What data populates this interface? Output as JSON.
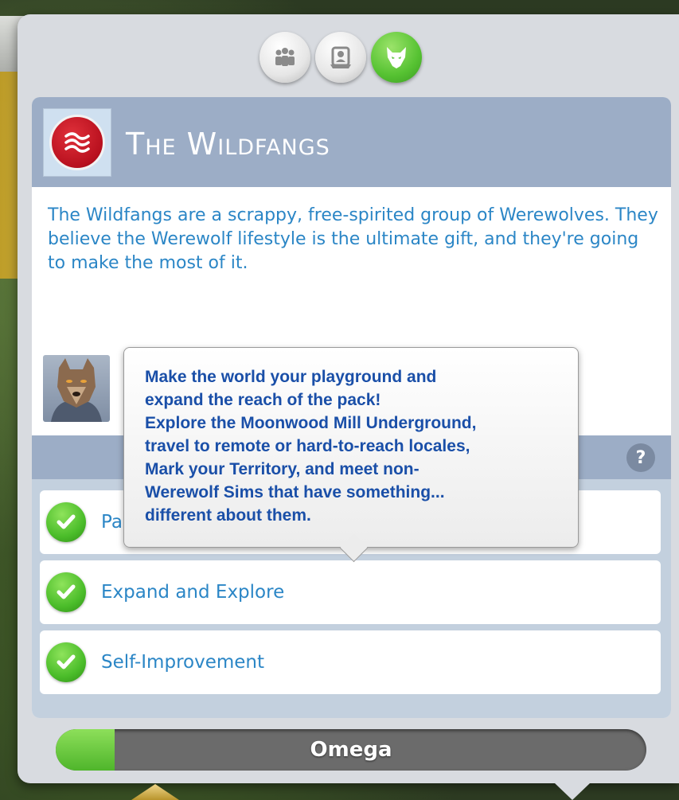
{
  "tabs": [
    {
      "icon": "group-icon",
      "active": false
    },
    {
      "icon": "portrait-badge-icon",
      "active": false
    },
    {
      "icon": "wolf-icon",
      "active": true
    }
  ],
  "pack": {
    "name": "The Wildfangs",
    "emblem_icon": "claw-marks-icon",
    "description": "The Wildfangs are a scrappy, free-spirited group of Werewolves. They believe the Werewolf lifestyle is the ultimate gift, and they're going to make the most of it."
  },
  "goals": {
    "help_label": "?",
    "items": [
      {
        "label": "Pa",
        "completed": true
      },
      {
        "label": "Expand and Explore",
        "completed": true
      },
      {
        "label": "Self-Improvement",
        "completed": true
      }
    ]
  },
  "tooltip": {
    "line1": "Make the world your playground and",
    "line2": "expand the reach of the pack!",
    "line3": "Explore the Moonwood Mill Underground,",
    "line4": "travel to remote or hard-to-reach locales,",
    "line5": "Mark your Territory, and meet non-",
    "line6": "Werewolf Sims that have something...",
    "line7": "different about them."
  },
  "rank": {
    "label": "Omega",
    "progress": 0.1
  },
  "colors": {
    "accent_blue": "#2b86c6",
    "header": "#9cadc6",
    "active_green": "#56c232",
    "emblem_red": "#c8141f"
  }
}
